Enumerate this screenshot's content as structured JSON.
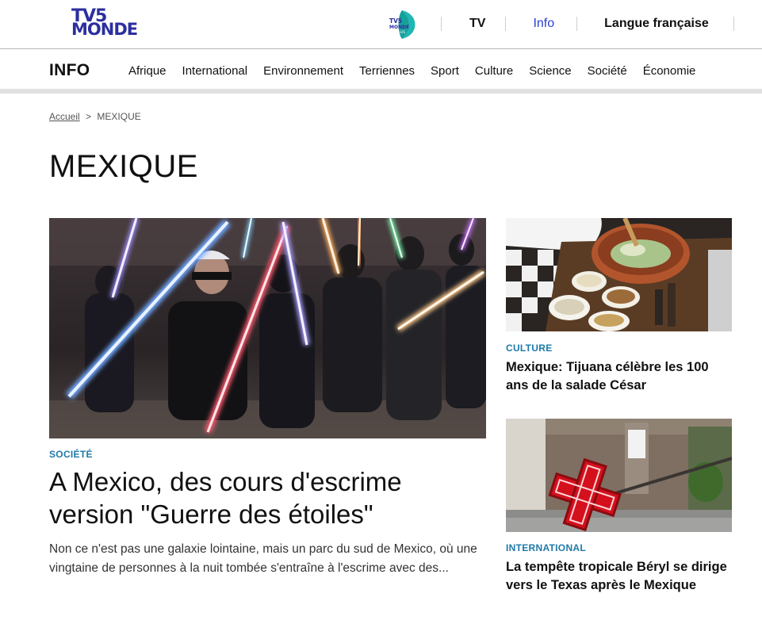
{
  "top_bar": {
    "logo_line1": "TV5",
    "logo_line2": "MONDE",
    "plus_logo_text": "TV5 MONDE PLUS",
    "links": [
      {
        "label": "TV",
        "active": false
      },
      {
        "label": "Info",
        "active": true
      },
      {
        "label": "Langue française",
        "active": false
      }
    ],
    "colors": {
      "brand_blue": "#2c2f9e",
      "active_link": "#2a3fce",
      "plus_teal": "#1fb7b2"
    }
  },
  "nav": {
    "brand": "INFO",
    "items": [
      "Afrique",
      "International",
      "Environnement",
      "Terriennes",
      "Sport",
      "Culture",
      "Science",
      "Société",
      "Économie"
    ]
  },
  "breadcrumb": {
    "home": "Accueil",
    "separator": ">",
    "current": "MEXIQUE"
  },
  "page": {
    "title": "MEXIQUE"
  },
  "main_article": {
    "image_icon": "lightsaber-photo",
    "category": "SOCIÉTÉ",
    "headline": "A Mexico, des cours d'escrime version \"Guerre des étoiles\"",
    "excerpt": "Non ce n'est pas une galaxie lointaine, mais un parc du sud de Mexico, où une vingtaine de personnes à la nuit tombée s'entraîne à l'escrime avec des..."
  },
  "side_articles": [
    {
      "image_icon": "salad-photo",
      "category": "CULTURE",
      "title": "Mexique: Tijuana célèbre les 100 ans de la salade César"
    },
    {
      "image_icon": "storm-pharmacy-sign-photo",
      "category": "INTERNATIONAL",
      "title": "La tempête tropicale Béryl se dirige vers le Texas après le Mexique"
    }
  ],
  "colors": {
    "category_blue": "#1e7aa8"
  }
}
